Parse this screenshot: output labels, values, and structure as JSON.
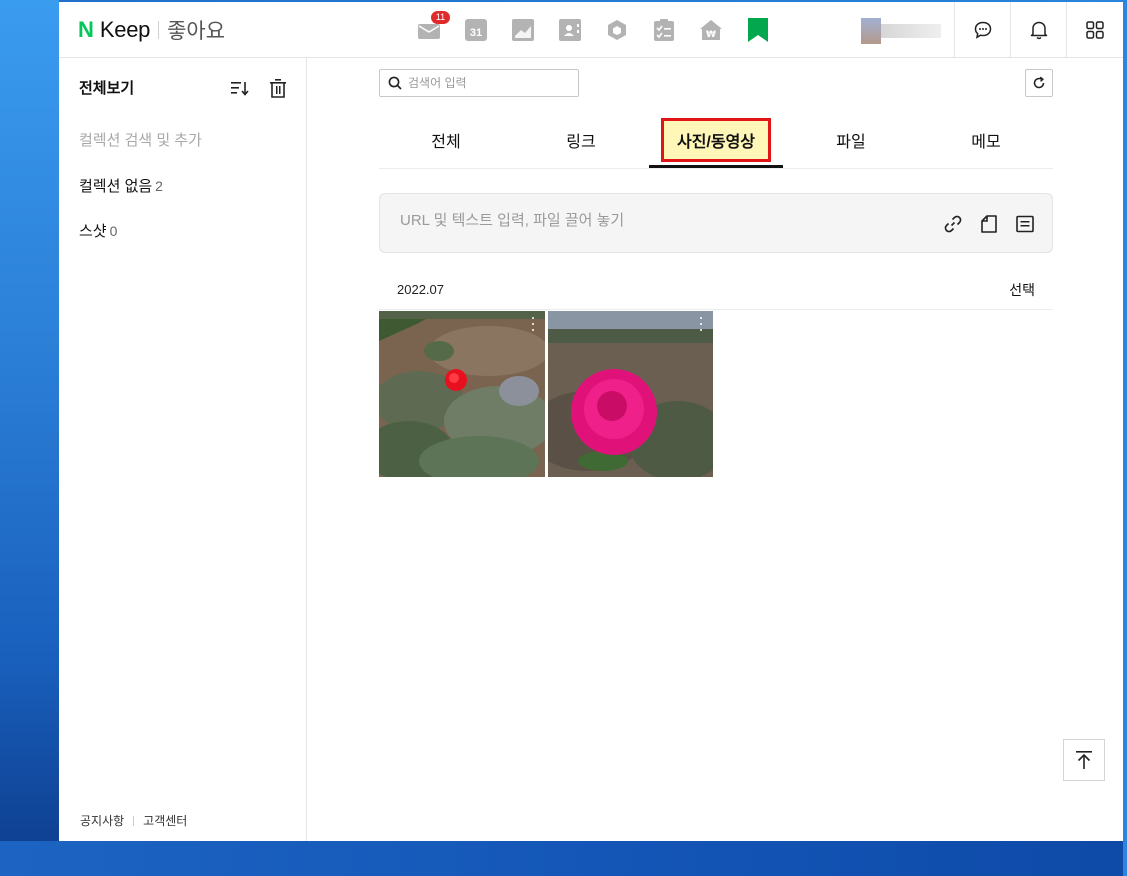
{
  "header": {
    "logo_mark": "N",
    "logo_text": "Keep",
    "collection_name": "좋아요",
    "services": [
      {
        "name": "mail-icon",
        "badge": "11"
      },
      {
        "name": "calendar-icon",
        "label": "31"
      },
      {
        "name": "photo-icon"
      },
      {
        "name": "contacts-icon"
      },
      {
        "name": "box-icon"
      },
      {
        "name": "todo-icon"
      },
      {
        "name": "home-pay-icon"
      },
      {
        "name": "keep-bookmark-icon",
        "color": "#03c75a"
      }
    ]
  },
  "sidebar": {
    "title": "전체보기",
    "search_add": "컬렉션 검색 및 추가",
    "items": [
      {
        "label": "컬렉션 없음",
        "count": "2"
      },
      {
        "label": "스샷",
        "count": "0"
      }
    ],
    "footer": [
      "공지사항",
      "고객센터"
    ]
  },
  "main": {
    "search_placeholder": "검색어 입력",
    "tabs": [
      "전체",
      "링크",
      "사진/동영상",
      "파일",
      "메모"
    ],
    "active_tab": "사진/동영상",
    "input_placeholder": "URL 및 텍스트 입력, 파일 끌어 놓기",
    "date_group": "2022.07",
    "select_label": "선택"
  },
  "colors": {
    "brand": "#03c75a",
    "highlight_bg": "#fff7b8",
    "highlight_border": "#e01515",
    "badge": "#e02b2b"
  }
}
